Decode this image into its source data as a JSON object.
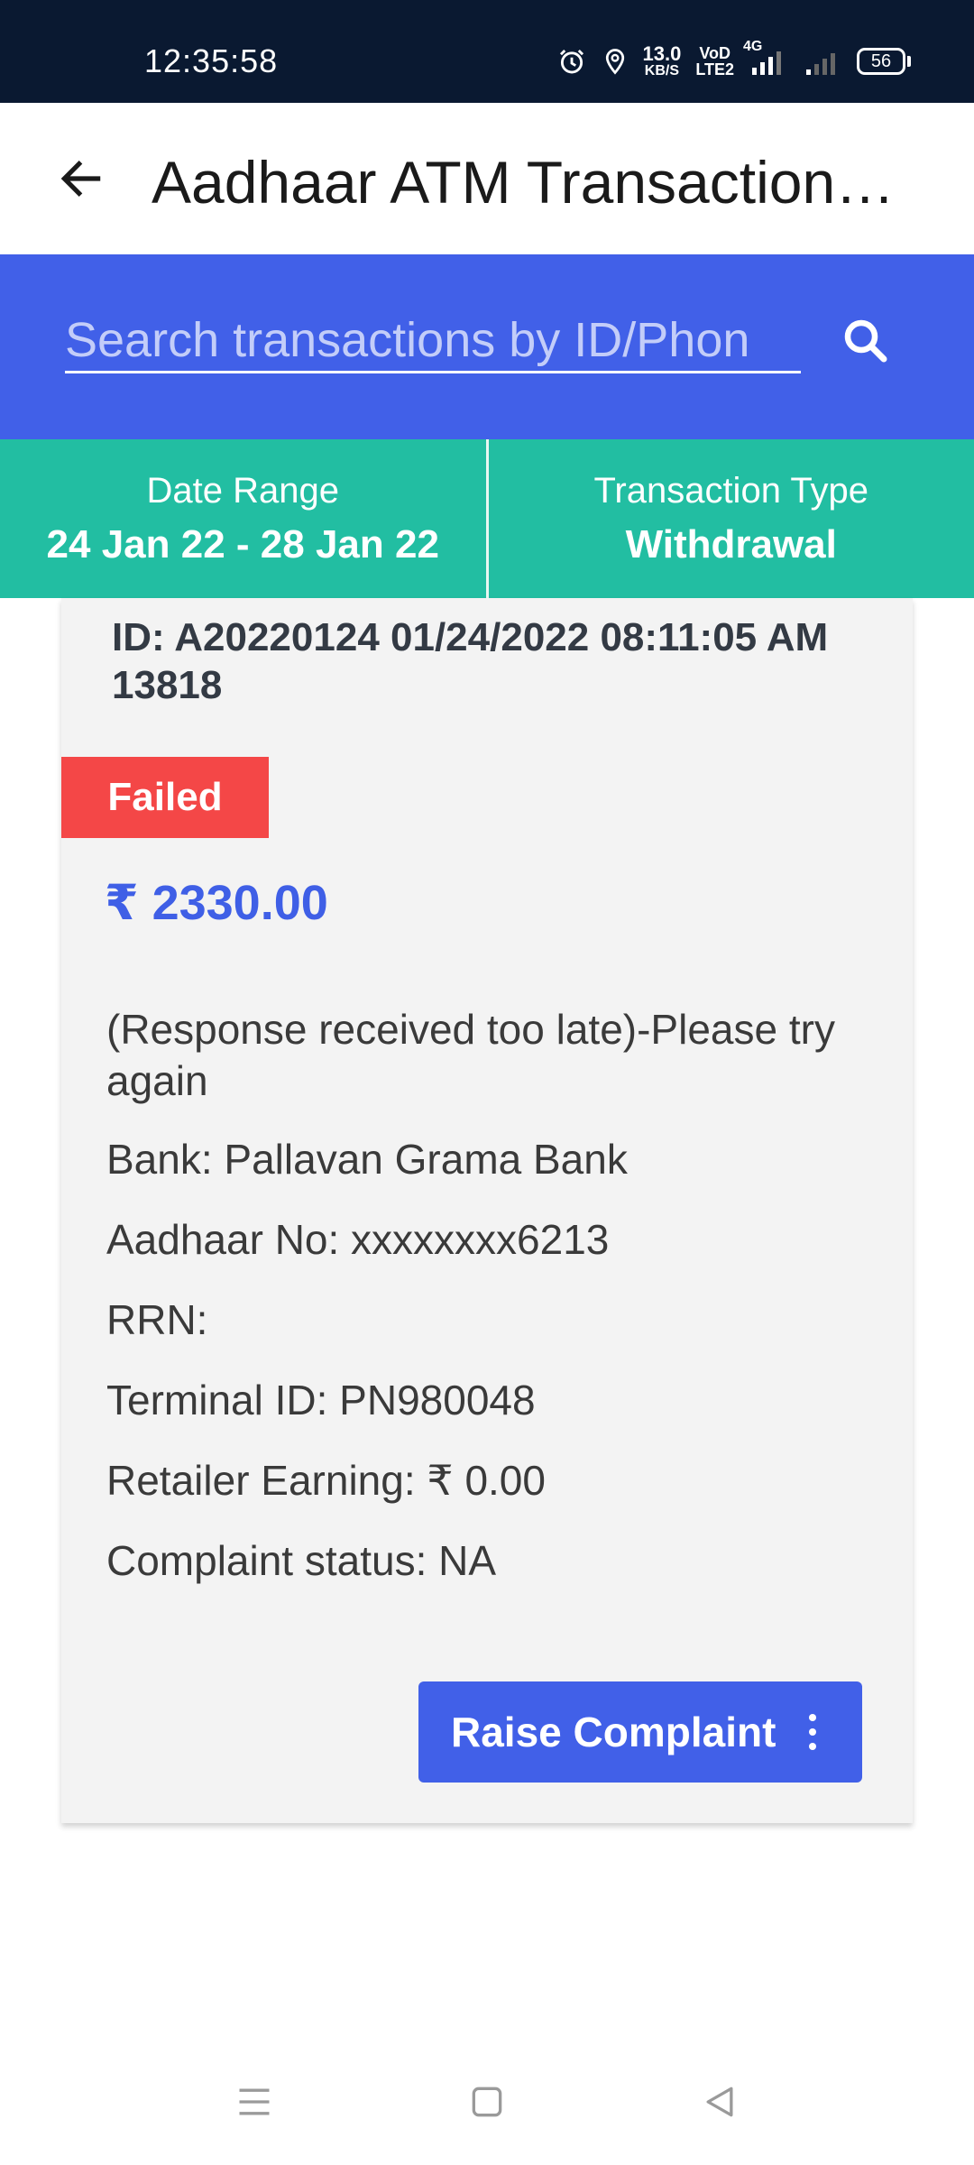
{
  "status_bar": {
    "time": "12:35:58",
    "net_speed_value": "13.0",
    "net_speed_unit": "KB/S",
    "volte_top": "VoD",
    "volte_bottom": "LTE2",
    "network": "4G",
    "battery": "56"
  },
  "app_bar": {
    "title": "Aadhaar ATM Transaction…"
  },
  "search": {
    "placeholder": "Search transactions by ID/Phon"
  },
  "filters": {
    "date_range_label": "Date Range",
    "date_range_value": "24 Jan 22 - 28 Jan 22",
    "txn_type_label": "Transaction Type",
    "txn_type_value": "Withdrawal"
  },
  "transaction": {
    "id_line": "ID: A20220124 01/24/2022 08:11:05 AM 13818",
    "status": "Failed",
    "amount": "₹ 2330.00",
    "message": "(Response received too late)-Please try again",
    "bank": "Bank: Pallavan Grama Bank",
    "aadhaar": "Aadhaar No: xxxxxxxx6213",
    "rrn": "RRN:",
    "terminal": "Terminal ID: PN980048",
    "earning": "Retailer Earning: ₹ 0.00",
    "complaint_status": "Complaint status: NA",
    "raise_button": "Raise Complaint"
  },
  "colors": {
    "status_bar_bg": "#0a1931",
    "primary_blue": "#4160e8",
    "teal": "#22bea2",
    "failed_red": "#f44747"
  }
}
